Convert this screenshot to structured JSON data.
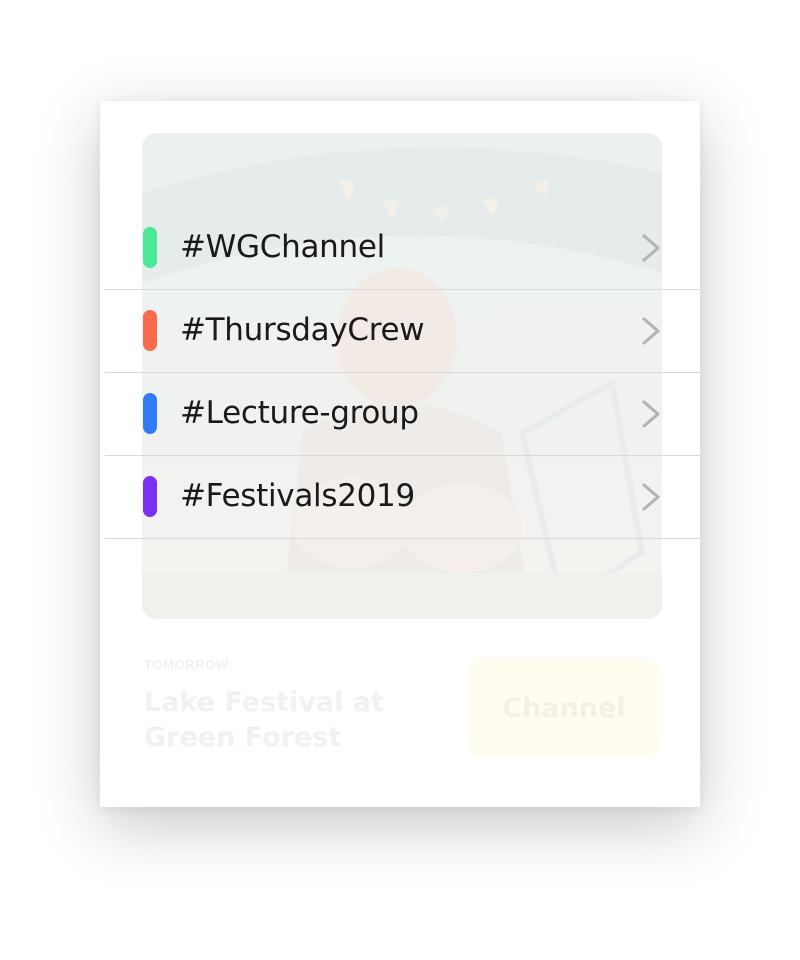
{
  "channels": [
    {
      "label": "#WGChannel",
      "color": "#4be898",
      "icon": "chevron-right-icon"
    },
    {
      "label": "#ThursdayCrew",
      "color": "#fa6a4f",
      "icon": "chevron-right-icon"
    },
    {
      "label": "#Lecture-group",
      "color": "#2f7cf6",
      "icon": "chevron-right-icon"
    },
    {
      "label": "#Festivals2019",
      "color": "#7a32f2",
      "icon": "chevron-right-icon"
    }
  ],
  "event": {
    "when": "TOMORROW",
    "title": "Lake Festival at Green Forest",
    "button_label": "Channel"
  },
  "colors": {
    "divider": "#d9d9d9",
    "chevron": "#b3b3b3",
    "text": "#1a1a1a"
  }
}
